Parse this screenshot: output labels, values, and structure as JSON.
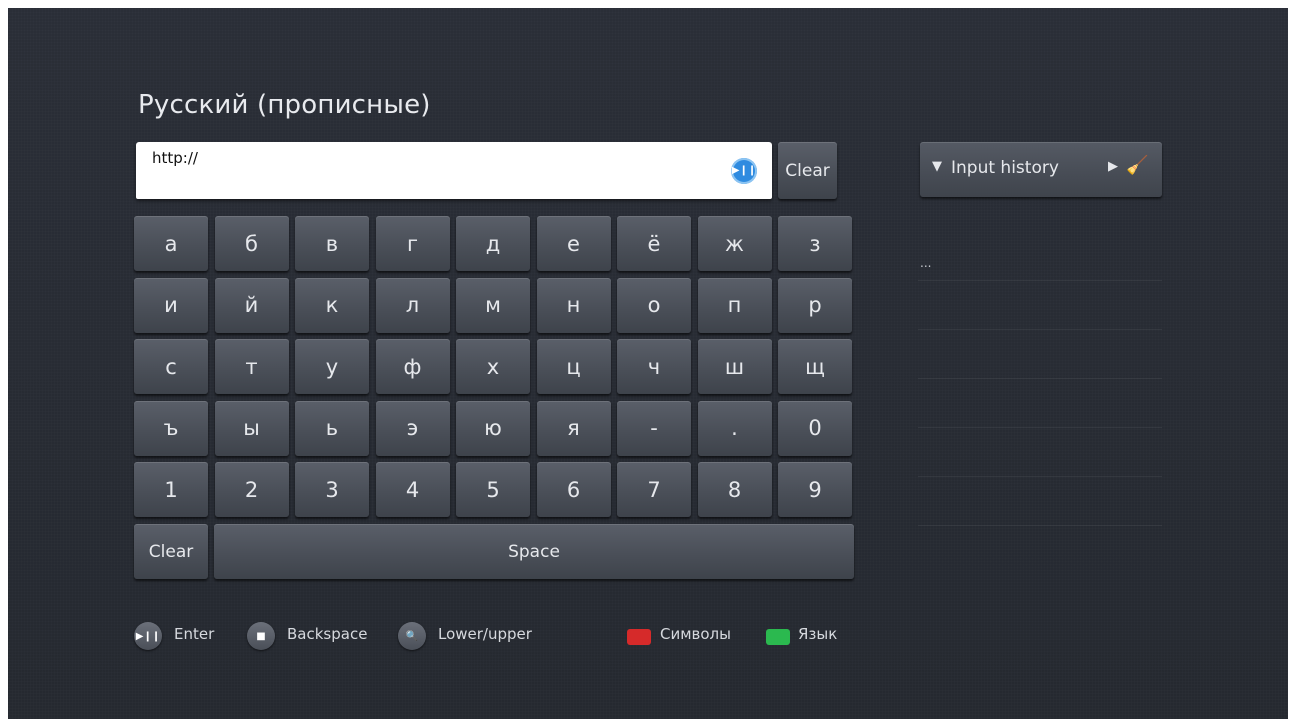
{
  "title": "Русский (прописные)",
  "input": {
    "value": "http://"
  },
  "clear_top_label": "Clear",
  "history": {
    "label": "Input history",
    "empty_item": "..."
  },
  "keys": {
    "row1": [
      "а",
      "б",
      "в",
      "г",
      "д",
      "е",
      "ё",
      "ж",
      "з"
    ],
    "row2": [
      "и",
      "й",
      "к",
      "л",
      "м",
      "н",
      "о",
      "п",
      "р"
    ],
    "row3": [
      "с",
      "т",
      "у",
      "ф",
      "х",
      "ц",
      "ч",
      "ш",
      "щ"
    ],
    "row4": [
      "ъ",
      "ы",
      "ь",
      "э",
      "ю",
      "я",
      "-",
      ".",
      "0"
    ],
    "row5": [
      "1",
      "2",
      "3",
      "4",
      "5",
      "6",
      "7",
      "8",
      "9"
    ],
    "clear_label": "Clear",
    "space_label": "Space"
  },
  "legend": {
    "enter": "Enter",
    "backspace": "Backspace",
    "case": "Lower/upper",
    "symbols": "Символы",
    "language": "Язык"
  },
  "colors": {
    "red": "#d62a2a",
    "green": "#2bb94f",
    "accent": "#2f8be0"
  }
}
